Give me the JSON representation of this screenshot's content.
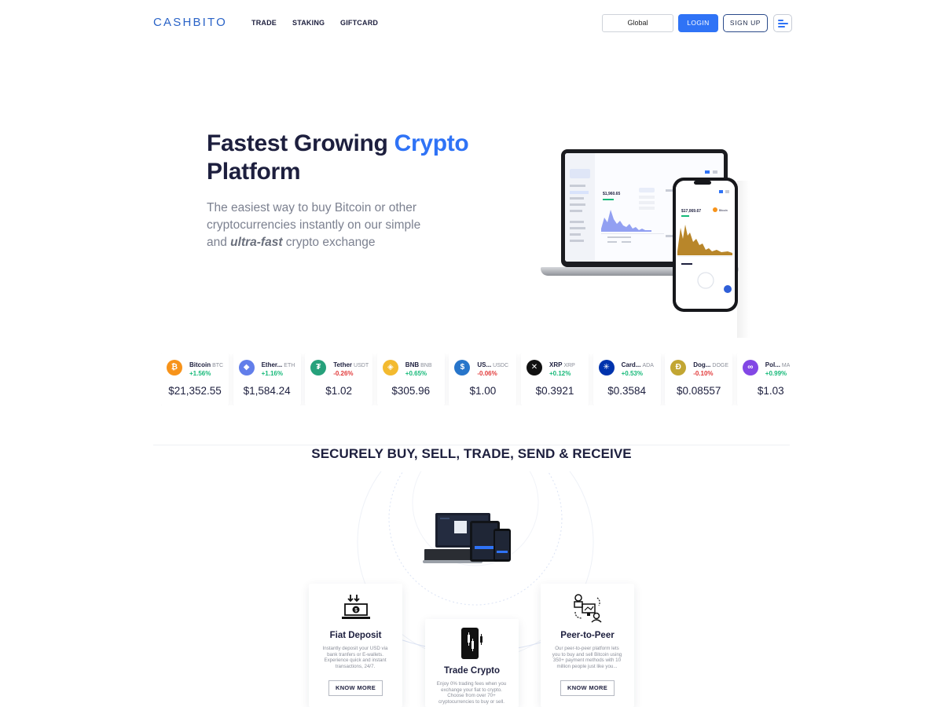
{
  "header": {
    "logo": "CASHBITO",
    "nav": [
      "TRADE",
      "STAKING",
      "GIFTCARD"
    ],
    "region": "Global",
    "login": "LOGIN",
    "signup": "SIGN UP"
  },
  "hero": {
    "title_main": "Fastest Growing ",
    "title_accent": "Crypto",
    "title_end": "Platform",
    "subtitle_part1": "The easiest way to buy Bitcoin or other cryptocurrencies instantly on our simple and ",
    "subtitle_emphasis": "ultra-fast",
    "subtitle_part2": " crypto exchange"
  },
  "device_mockup": {
    "laptop_balance": "$1,960.65",
    "phone_balance": "$17,069.67",
    "phone_coin": "Bitcoin"
  },
  "ticker": [
    {
      "name": "Bitcoin",
      "symbol": "BTC",
      "change": "+1.56%",
      "price": "$21,352.55",
      "color": "#f7931a",
      "glyph": "₿",
      "dir": "up"
    },
    {
      "name": "Ether...",
      "symbol": "ETH",
      "change": "+1.16%",
      "price": "$1,584.24",
      "color": "#627eea",
      "glyph": "◆",
      "dir": "up"
    },
    {
      "name": "Tether",
      "symbol": "USDT",
      "change": "-0.26%",
      "price": "$1.02",
      "color": "#26a17b",
      "glyph": "₮",
      "dir": "down"
    },
    {
      "name": "BNB",
      "symbol": "BNB",
      "change": "+0.65%",
      "price": "$305.96",
      "color": "#f3ba2f",
      "glyph": "◈",
      "dir": "up"
    },
    {
      "name": "US...",
      "symbol": "USDC",
      "change": "-0.06%",
      "price": "$1.00",
      "color": "#2775ca",
      "glyph": "$",
      "dir": "down"
    },
    {
      "name": "XRP",
      "symbol": "XRP",
      "change": "+0.12%",
      "price": "$0.3921",
      "color": "#111111",
      "glyph": "✕",
      "dir": "up"
    },
    {
      "name": "Card...",
      "symbol": "ADA",
      "change": "+0.53%",
      "price": "$0.3584",
      "color": "#0033ad",
      "glyph": "✳",
      "dir": "up"
    },
    {
      "name": "Dog...",
      "symbol": "DOGE",
      "change": "-0.10%",
      "price": "$0.08557",
      "color": "#c2a633",
      "glyph": "Ð",
      "dir": "down"
    },
    {
      "name": "Pol...",
      "symbol": "MATIC",
      "change": "+0.99%",
      "price": "$1.03",
      "color": "#8247e5",
      "glyph": "∞",
      "dir": "up"
    }
  ],
  "section": {
    "title": "SECURELY BUY, SELL, TRADE, SEND & RECEIVE"
  },
  "features": [
    {
      "title": "Fiat Deposit",
      "desc": "Instantly deposit your USD via bank tranfers or E-wallets. Experience quick and instant transactions, 24/7.",
      "button": "KNOW MORE",
      "icon": "cash-deposit-icon"
    },
    {
      "title": "Trade Crypto",
      "desc": "Enjoy 0% trading fees when you exchange your fiat to crypto. Choose from over 70+ cryptocurrencies to buy or sell.",
      "icon": "phone-candlestick-icon"
    },
    {
      "title": "Peer-to-Peer",
      "desc": "Our peer-to-peer platform lets you to buy and sell Bitcoin using 350+ payment methods with 10 million people just like you...",
      "button": "KNOW MORE",
      "icon": "peer-exchange-icon"
    }
  ],
  "colors": {
    "brand": "#2f73f6",
    "logo": "#2a63c7",
    "text_dark": "#1d1f3e",
    "positive": "#16b979",
    "negative": "#e23b3b"
  }
}
